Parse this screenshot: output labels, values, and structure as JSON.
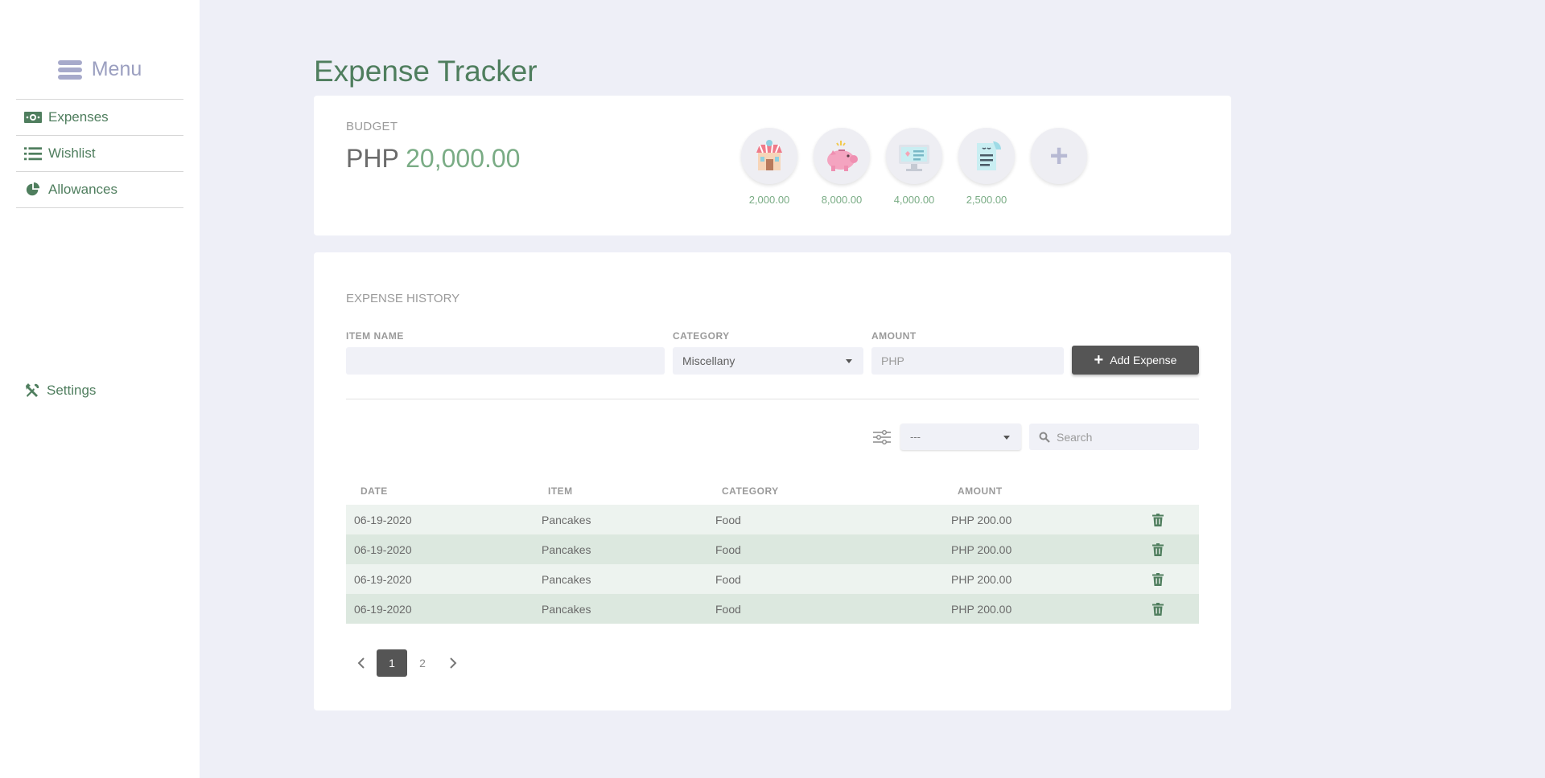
{
  "sidebar": {
    "menu_label": "Menu",
    "items": [
      {
        "label": "Expenses",
        "icon": "money-bill-icon"
      },
      {
        "label": "Wishlist",
        "icon": "list-icon"
      },
      {
        "label": "Allowances",
        "icon": "pie-chart-icon"
      }
    ],
    "settings_label": "Settings"
  },
  "page": {
    "title": "Expense Tracker"
  },
  "budget": {
    "label": "BUDGET",
    "currency": "PHP",
    "amount": "20,000.00",
    "allowances": [
      {
        "icon": "store-icon",
        "amount": "2,000.00"
      },
      {
        "icon": "piggy-bank-icon",
        "amount": "8,000.00"
      },
      {
        "icon": "computer-icon",
        "amount": "4,000.00"
      },
      {
        "icon": "receipt-icon",
        "amount": "2,500.00"
      }
    ],
    "add_symbol": "+"
  },
  "history": {
    "title": "EXPENSE HISTORY",
    "form": {
      "item_label": "ITEM NAME",
      "item_value": "",
      "category_label": "CATEGORY",
      "category_value": "Miscellany",
      "amount_label": "AMOUNT",
      "amount_placeholder": "PHP",
      "add_button": "Add Expense"
    },
    "filter": {
      "selected": "---",
      "search_placeholder": "Search"
    },
    "columns": [
      "DATE",
      "ITEM",
      "CATEGORY",
      "AMOUNT"
    ],
    "rows": [
      {
        "date": "06-19-2020",
        "item": "Pancakes",
        "category": "Food",
        "amount": "PHP 200.00"
      },
      {
        "date": "06-19-2020",
        "item": "Pancakes",
        "category": "Food",
        "amount": "PHP 200.00"
      },
      {
        "date": "06-19-2020",
        "item": "Pancakes",
        "category": "Food",
        "amount": "PHP 200.00"
      },
      {
        "date": "06-19-2020",
        "item": "Pancakes",
        "category": "Food",
        "amount": "PHP 200.00"
      }
    ],
    "pagination": {
      "pages": [
        "1",
        "2"
      ],
      "current": "1"
    }
  },
  "colors": {
    "accent_green": "#4f7e5e",
    "amount_green": "#7aac85",
    "menu_lavender": "#9b9fc0",
    "dark_button": "#555555",
    "page_bg": "#eeeff7"
  }
}
